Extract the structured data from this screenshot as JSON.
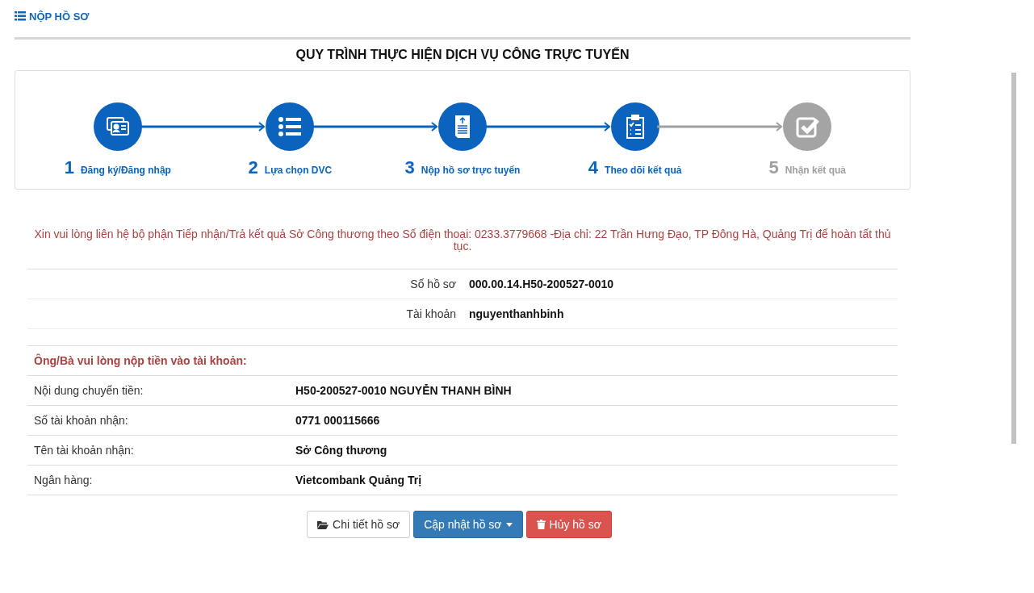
{
  "page_title": "NỘP HỒ SƠ",
  "process": {
    "title": "QUY TRÌNH THỰC HIỆN DỊCH VỤ CÔNG TRỰC TUYẾN",
    "steps": [
      {
        "number": "1",
        "label": "Đăng ký/Đăng nhập",
        "done": true,
        "kind": "id-card"
      },
      {
        "number": "2",
        "label": "Lựa chọn DVC",
        "done": true,
        "kind": "list"
      },
      {
        "number": "3",
        "label": "Nộp hồ sơ trực tuyến",
        "done": true,
        "kind": "upload"
      },
      {
        "number": "4",
        "label": "Theo dõi kết quả",
        "done": true,
        "kind": "clipboard"
      },
      {
        "number": "5",
        "label": "Nhận kết quả",
        "done": false,
        "kind": "check"
      }
    ]
  },
  "notice": "Xin vui lòng liên hệ bộ phận Tiếp nhận/Trả kết quả Sở Công thương theo Số điện thoại: 0233.3779668 -Địa chỉ: 22 Trần Hưng Đạo, TP Đông Hà, Quảng Trị để hoàn tất thủ tục.",
  "record": [
    {
      "label": "Số hồ sơ",
      "value": "000.00.14.H50-200527-0010"
    },
    {
      "label": "Tài khoản",
      "value": "nguyenthanhbinh"
    }
  ],
  "payment": {
    "heading": "Ông/Bà vui lòng nộp tiền vào tài khoản:",
    "rows": [
      {
        "label": "Nội dung chuyển tiền:",
        "value": "H50-200527-0010 NGUYỄN THANH BÌNH"
      },
      {
        "label": "Số tài khoản nhận:",
        "value": "0771 000115666"
      },
      {
        "label": "Tên tài khoản nhận:",
        "value": "Sở Công thương"
      },
      {
        "label": "Ngân hàng:",
        "value": "Vietcombank Quảng Trị"
      }
    ]
  },
  "buttons": [
    {
      "label": "Chi tiết hồ sơ",
      "kind": "default"
    },
    {
      "label": "Cập nhật hồ sơ",
      "kind": "primary"
    },
    {
      "label": "Hủy hồ sơ",
      "kind": "danger"
    }
  ]
}
